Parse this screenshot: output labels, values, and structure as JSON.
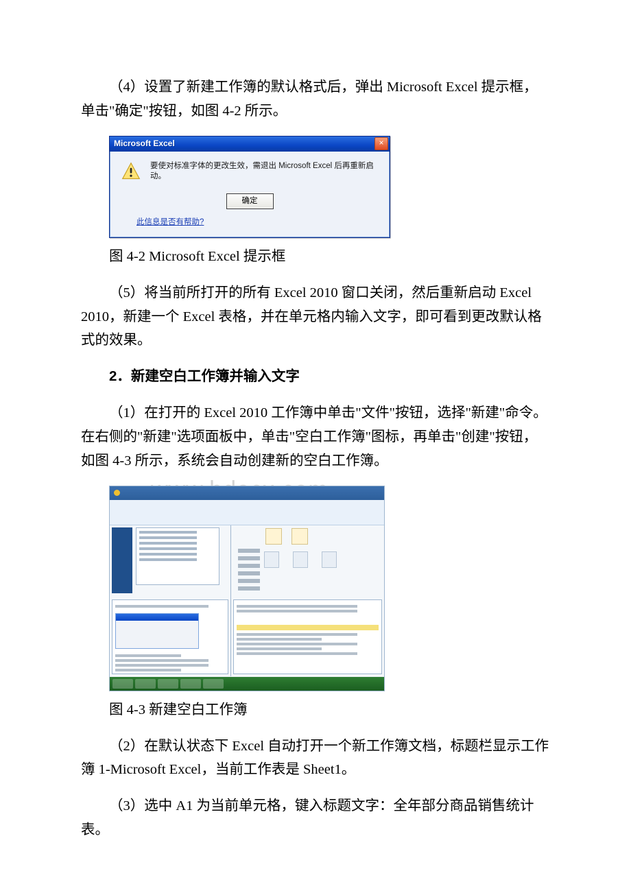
{
  "p1": "（4）设置了新建工作簿的默认格式后，弹出 Microsoft Excel 提示框，单击\"确定\"按钮，如图 4-2 所示。",
  "dialog42": {
    "title": "Microsoft Excel",
    "close_glyph": "×",
    "message": "要使对标准字体的更改生效，需退出 Microsoft Excel 后再重新启动。",
    "ok_label": "确定",
    "help_link": "此信息是否有帮助?"
  },
  "caption42": "图 4-2 Microsoft Excel 提示框",
  "p2": "（5）将当前所打开的所有 Excel 2010 窗口关闭，然后重新启动 Excel 2010，新建一个 Excel 表格，并在单元格内输入文字，即可看到更改默认格式的效果。",
  "h2": "2．新建空白工作簿并输入文字",
  "p3": "（1）在打开的 Excel 2010 工作簿中单击\"文件\"按钮，选择\"新建\"命令。在右侧的\"新建\"选项面板中，单击\"空白工作簿\"图标，再单击\"创建\"按钮，如图 4-3 所示，系统会自动创建新的空白工作簿。",
  "watermark": "www.bdocx.com",
  "caption43": "图 4-3 新建空白工作簿",
  "p4": "（2）在默认状态下 Excel 自动打开一个新工作簿文档，标题栏显示工作簿 1-Microsoft Excel，当前工作表是 Sheet1。",
  "p5": "（3）选中 A1 为当前单元格，键入标题文字：全年部分商品销售统计表。"
}
